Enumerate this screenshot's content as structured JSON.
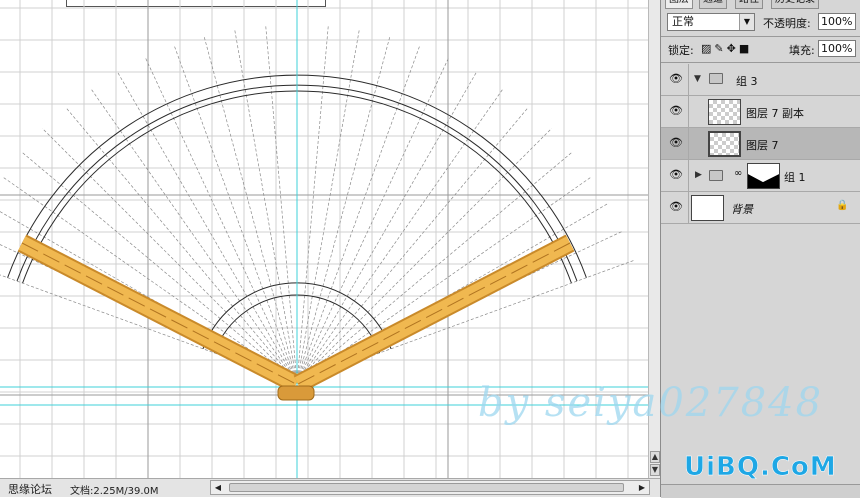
{
  "status_bar": {
    "left_text": "思缘论坛",
    "doc_info": "文档:2.25M/39.0M"
  },
  "layers_panel": {
    "tabs": [
      "图层",
      "通道",
      "路径",
      "历史记录"
    ],
    "blend_mode": "正常",
    "opacity_label": "不透明度:",
    "opacity_value": "100%",
    "lock_label": "锁定:",
    "fill_label": "填充:",
    "fill_value": "100%",
    "layers": [
      {
        "name": "组 3",
        "type": "group",
        "expanded": true
      },
      {
        "name": "图层 7 副本",
        "type": "layer"
      },
      {
        "name": "图层 7",
        "type": "layer",
        "selected": true
      },
      {
        "name": "组 1",
        "type": "group",
        "expanded": false
      },
      {
        "name": "背景",
        "type": "background",
        "locked": true
      }
    ]
  },
  "watermarks": {
    "site": "UiBQ.CoM",
    "signature": "by seiya027848"
  },
  "colors": {
    "guide": "#3fd0d8",
    "rib_wood": "#e8a838",
    "grid": "#cfcfcf",
    "watermark_blue": "#1ea7e5"
  },
  "icons": {
    "eye": "eye-icon",
    "folder": "folder-icon",
    "lock": "lock-icon",
    "link": "link-icon"
  }
}
